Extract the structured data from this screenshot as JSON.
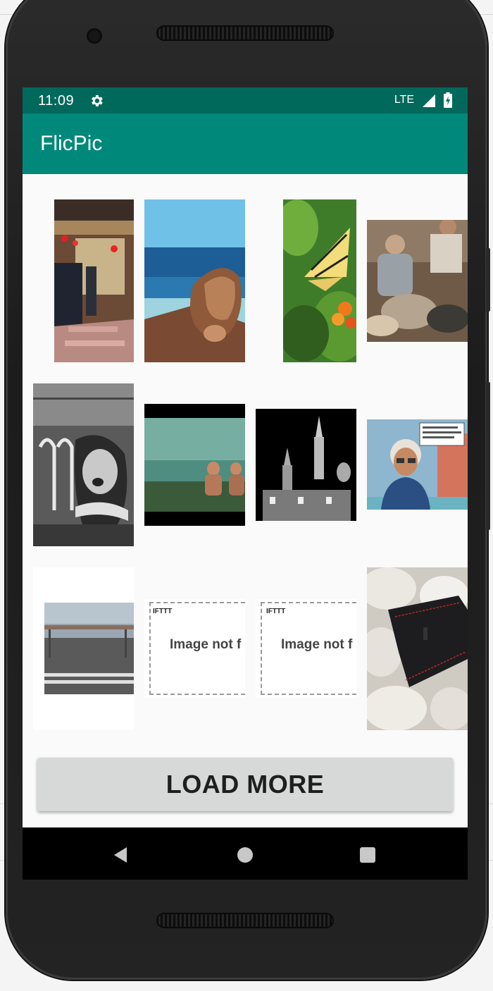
{
  "status_bar": {
    "time": "11:09",
    "network": "LTE",
    "icons": [
      "gear-icon",
      "signal-icon",
      "battery-charging-icon"
    ]
  },
  "app_bar": {
    "title": "FlicPic"
  },
  "gallery": {
    "tiles": [
      {
        "name": "photo-market-street",
        "description_icon": "photo"
      },
      {
        "name": "photo-rock-sea",
        "description_icon": "photo"
      },
      {
        "name": "photo-butterfly",
        "description_icon": "photo"
      },
      {
        "name": "photo-people-kitchen",
        "description_icon": "photo"
      },
      {
        "name": "photo-person-eating",
        "description_icon": "photo"
      },
      {
        "name": "photo-swimmers",
        "description_icon": "photo"
      },
      {
        "name": "photo-basilica-night",
        "description_icon": "photo"
      },
      {
        "name": "photo-cartoon-avatar",
        "description_icon": "photo"
      },
      {
        "name": "photo-road-no-entry",
        "description_icon": "photo"
      },
      {
        "name": "photo-image-not-found-1",
        "placeholder_brand": "IFTTT",
        "placeholder_text": "Image not f"
      },
      {
        "name": "photo-image-not-found-2",
        "placeholder_brand": "IFTTT",
        "placeholder_text": "Image not f"
      },
      {
        "name": "photo-watch-strap-stones",
        "description_icon": "photo"
      }
    ]
  },
  "actions": {
    "load_more_label": "LOAD MORE"
  },
  "nav_bar": {
    "icons": [
      "back-icon",
      "home-icon",
      "recents-icon"
    ]
  },
  "colors": {
    "status_bar": "#00695c",
    "app_bar": "#00897b",
    "screen_bg": "#fafafa",
    "button_bg": "#d7d8d8"
  }
}
